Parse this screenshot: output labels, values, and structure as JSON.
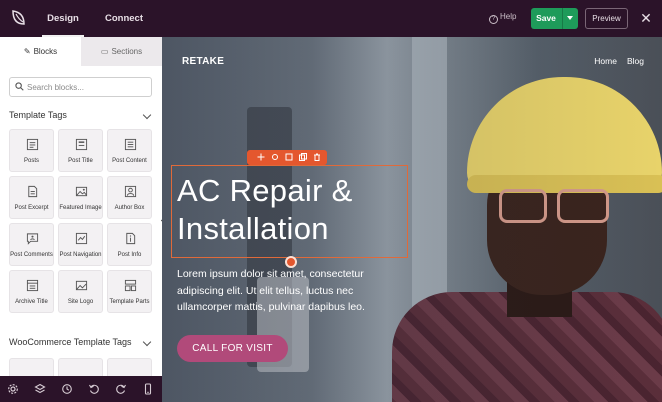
{
  "topbar": {
    "tabs": [
      {
        "label": "Design"
      },
      {
        "label": "Connect"
      }
    ],
    "help_label": "Help",
    "save_label": "Save",
    "preview_label": "Preview",
    "accent_color": "#1e9b5a"
  },
  "sidebar": {
    "tabs": [
      {
        "label": "Blocks",
        "icon": "blocks-icon"
      },
      {
        "label": "Sections",
        "icon": "sections-icon"
      }
    ],
    "search": {
      "placeholder": "Search blocks...",
      "value": ""
    },
    "template_tags": {
      "title": "Template Tags",
      "items": [
        {
          "label": "Posts",
          "icon": "posts-icon"
        },
        {
          "label": "Post Title",
          "icon": "post-title-icon"
        },
        {
          "label": "Post Content",
          "icon": "post-content-icon"
        },
        {
          "label": "Post Excerpt",
          "icon": "post-excerpt-icon"
        },
        {
          "label": "Featured Image",
          "icon": "featured-image-icon"
        },
        {
          "label": "Author Box",
          "icon": "author-box-icon"
        },
        {
          "label": "Post Comments",
          "icon": "post-comments-icon"
        },
        {
          "label": "Post Navigation",
          "icon": "post-navigation-icon"
        },
        {
          "label": "Post Info",
          "icon": "post-info-icon"
        },
        {
          "label": "Archive Title",
          "icon": "archive-title-icon"
        },
        {
          "label": "Site Logo",
          "icon": "site-logo-icon"
        },
        {
          "label": "Template Parts",
          "icon": "template-parts-icon"
        }
      ]
    },
    "woo_tags": {
      "title": "WooCommerce Template Tags"
    }
  },
  "canvas": {
    "brand": "RETAKE",
    "nav": [
      "Home",
      "Blog"
    ],
    "hero_title": "AC Repair & Installation",
    "hero_text": "Lorem ipsum dolor sit amet, consectetur adipiscing elit. Ut elit tellus, luctus nec ullamcorper mattis, pulvinar dapibus leo.",
    "cta_label": "CALL FOR VISIT",
    "cta_color": "#b14a7a",
    "selection_color": "#e4572e"
  }
}
